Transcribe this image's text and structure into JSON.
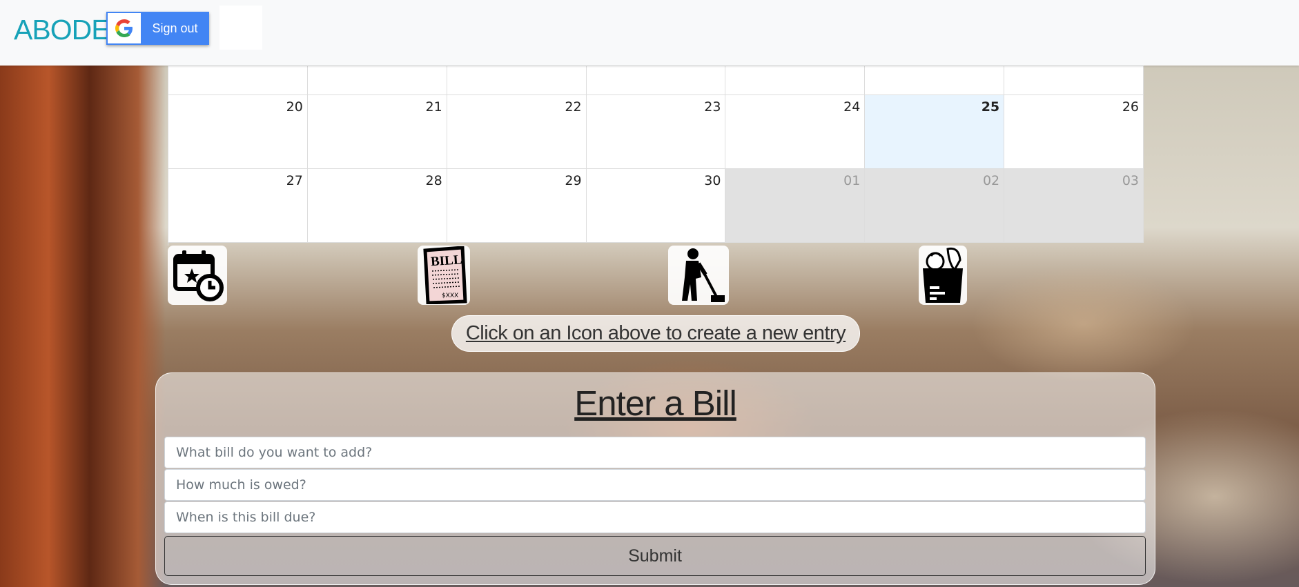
{
  "navbar": {
    "brand": "ABODE",
    "signout_label": "Sign out"
  },
  "calendar": {
    "weeks": [
      [
        {
          "day": "",
          "state": "normal"
        },
        {
          "day": "",
          "state": "normal"
        },
        {
          "day": "",
          "state": "normal"
        },
        {
          "day": "",
          "state": "normal"
        },
        {
          "day": "",
          "state": "normal"
        },
        {
          "day": "",
          "state": "normal"
        },
        {
          "day": "",
          "state": "normal"
        }
      ],
      [
        {
          "day": "20",
          "state": "normal"
        },
        {
          "day": "21",
          "state": "normal"
        },
        {
          "day": "22",
          "state": "normal"
        },
        {
          "day": "23",
          "state": "normal"
        },
        {
          "day": "24",
          "state": "normal"
        },
        {
          "day": "25",
          "state": "today"
        },
        {
          "day": "26",
          "state": "normal"
        }
      ],
      [
        {
          "day": "27",
          "state": "normal"
        },
        {
          "day": "28",
          "state": "normal"
        },
        {
          "day": "29",
          "state": "normal"
        },
        {
          "day": "30",
          "state": "normal"
        },
        {
          "day": "01",
          "state": "other"
        },
        {
          "day": "02",
          "state": "other"
        },
        {
          "day": "03",
          "state": "other"
        }
      ]
    ]
  },
  "entry_icons": [
    {
      "name": "calendar-event-icon"
    },
    {
      "name": "bill-icon",
      "label": "BILL",
      "amount": "$XXX"
    },
    {
      "name": "cleaning-chore-icon"
    },
    {
      "name": "grocery-bag-icon"
    }
  ],
  "hint_text": "Click on an Icon above to create a new entry",
  "bill_form": {
    "title": "Enter a Bill",
    "bill_placeholder": "What bill do you want to add?",
    "amount_placeholder": "How much is owed?",
    "due_placeholder": "When is this bill due?",
    "submit_label": "Submit"
  },
  "colors": {
    "brand": "#17a2b8",
    "google_blue": "#4285f4",
    "today_bg": "#e8f4fe",
    "other_month_bg": "#e1e1e1"
  }
}
